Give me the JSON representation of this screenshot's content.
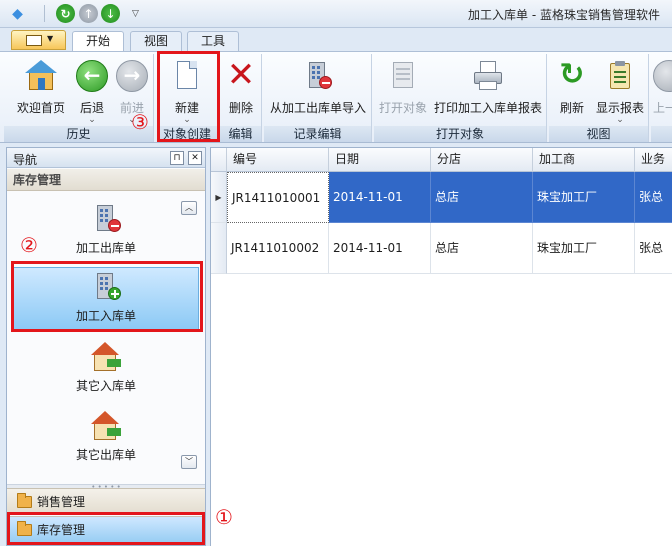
{
  "window": {
    "title": "加工入库单 - 蓝格珠宝销售管理软件"
  },
  "tabs": [
    {
      "label": "开始",
      "active": true
    },
    {
      "label": "视图",
      "active": false
    },
    {
      "label": "工具",
      "active": false
    }
  ],
  "ribbon": {
    "groups": [
      {
        "label": "历史"
      },
      {
        "label": "对象创建"
      },
      {
        "label": "编辑"
      },
      {
        "label": "记录编辑"
      },
      {
        "label": "打开对象"
      },
      {
        "label": "视图"
      }
    ],
    "buttons": {
      "home": "欢迎首页",
      "back": "后退",
      "forward": "前进",
      "new": "新建",
      "delete": "删除",
      "import": "从加工出库单导入",
      "open": "打开对象",
      "print": "打印加工入库单报表",
      "refresh": "刷新",
      "show_report": "显示报表",
      "prev": "上一"
    }
  },
  "nav": {
    "title": "导航",
    "group_title": "库存管理",
    "items": [
      {
        "label": "加工出库单"
      },
      {
        "label": "加工入库单"
      },
      {
        "label": "其它入库单"
      },
      {
        "label": "其它出库单"
      }
    ],
    "categories": [
      {
        "label": "销售管理"
      },
      {
        "label": "库存管理"
      }
    ]
  },
  "grid": {
    "columns": [
      "编号",
      "日期",
      "分店",
      "加工商",
      "业务员"
    ],
    "rows": [
      {
        "code": "JR1411010001",
        "date": "2014-11-01",
        "branch": "总店",
        "processor": "珠宝加工厂",
        "staff": "张总"
      },
      {
        "code": "JR1411010002",
        "date": "2014-11-01",
        "branch": "总店",
        "processor": "珠宝加工厂",
        "staff": "张总"
      }
    ]
  },
  "callouts": [
    "①",
    "②",
    "③"
  ],
  "colors": {
    "selection": "#3168c7",
    "callout": "#e3161b",
    "nav_selected": "#8bc9f5"
  }
}
